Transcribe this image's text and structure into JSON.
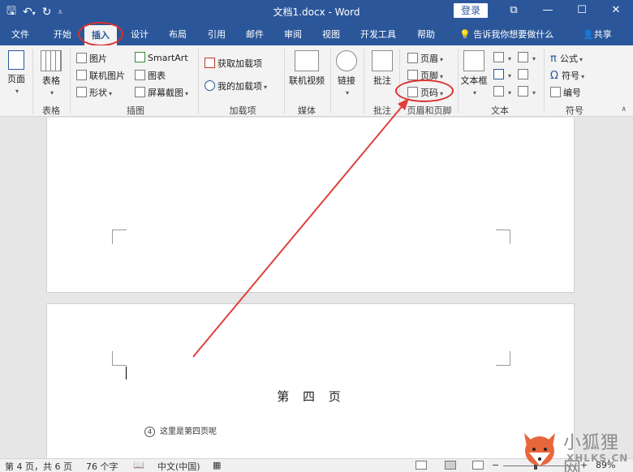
{
  "window": {
    "title": "文档1.docx  -  Word",
    "login_label": "登录",
    "controls": [
      "⧉",
      "—",
      "☐",
      "✕"
    ]
  },
  "qat": {
    "save_icon": "save-icon",
    "undo_icon": "undo-icon",
    "redo_icon": "redo-icon",
    "customize_icon": "customize-qat-icon"
  },
  "tabs": [
    {
      "label": "文件"
    },
    {
      "label": "开始"
    },
    {
      "label": "插入"
    },
    {
      "label": "设计"
    },
    {
      "label": "布局"
    },
    {
      "label": "引用"
    },
    {
      "label": "邮件"
    },
    {
      "label": "审阅"
    },
    {
      "label": "视图"
    },
    {
      "label": "开发工具"
    },
    {
      "label": "帮助"
    }
  ],
  "active_tab": "插入",
  "tell_me": "告诉我你想要做什么",
  "share": "共享",
  "ribbon": {
    "pages": {
      "label": "页面",
      "group": ""
    },
    "table": {
      "label": "表格",
      "group": "表格"
    },
    "illustrations": {
      "group": "插图",
      "picture": "图片",
      "online_picture": "联机图片",
      "shapes": "形状",
      "smartart": "SmartArt",
      "chart": "图表",
      "screenshot": "屏幕截图"
    },
    "addins": {
      "group": "加载项",
      "get": "获取加载项",
      "my": "我的加载项"
    },
    "media": {
      "group": "媒体",
      "online_video": "联机视频"
    },
    "links": {
      "label": "链接"
    },
    "comments": {
      "group": "批注",
      "comment": "批注"
    },
    "header_footer": {
      "group": "页眉和页脚",
      "header": "页眉",
      "footer": "页脚",
      "page_number": "页码"
    },
    "text": {
      "group": "文本",
      "textbox": "文本框"
    },
    "symbols": {
      "group": "符号",
      "equation": "公式",
      "symbol": "符号",
      "numbering": "编号"
    }
  },
  "document": {
    "heading": "第 四 页",
    "footnote_mark": "④",
    "footnote_text": "这里是第四页呢"
  },
  "status": {
    "page": "第 4 页，共 6 页",
    "words": "76 个字",
    "language": "中文(中国)",
    "zoom": "89%",
    "zoom_value": 89
  },
  "watermark": {
    "line1": "小狐狸网",
    "line2": "XHLKS.CN"
  },
  "colors": {
    "accent": "#2b579a",
    "annotation": "#d9312f"
  }
}
